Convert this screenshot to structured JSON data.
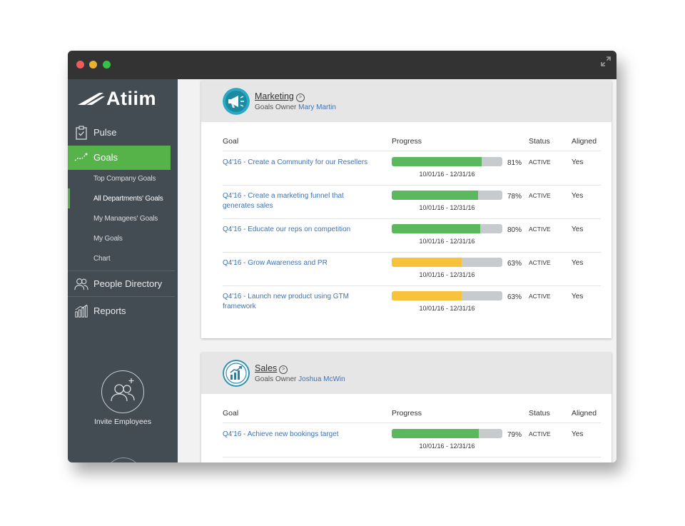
{
  "app": {
    "logo_text": "Atiim"
  },
  "sidebar": {
    "nav": [
      {
        "label": "Pulse",
        "icon": "clipboard-icon"
      },
      {
        "label": "Goals",
        "icon": "trend-icon"
      }
    ],
    "goals_submenu": [
      "Top Company Goals",
      "All Departments' Goals",
      "My Managees' Goals",
      "My Goals",
      "Chart"
    ],
    "active_submenu": "All Departments' Goals",
    "people": {
      "label": "People Directory",
      "icon": "people-icon"
    },
    "reports": {
      "label": "Reports",
      "icon": "bar-chart-icon"
    },
    "invite": {
      "label": "Invite Employees",
      "icon": "add-people-icon"
    }
  },
  "columns": {
    "goal": "Goal",
    "progress": "Progress",
    "status": "Status",
    "aligned": "Aligned"
  },
  "departments": [
    {
      "name": "Marketing",
      "owner_label": "Goals Owner",
      "owner": "Mary Martin",
      "icon": "megaphone-icon",
      "goals": [
        {
          "title": "Q4'16 - Create a Community for our Resellers",
          "progress": 81,
          "color": "#5cb85c",
          "dates": "10/01/16 - 12/31/16",
          "status": "ACTIVE",
          "aligned": "Yes"
        },
        {
          "title": "Q4'16 - Create a marketing funnel that generates sales",
          "progress": 78,
          "color": "#5cb85c",
          "dates": "10/01/16 - 12/31/16",
          "status": "ACTIVE",
          "aligned": "Yes"
        },
        {
          "title": "Q4'16 - Educate our reps on competition",
          "progress": 80,
          "color": "#5cb85c",
          "dates": "10/01/16 - 12/31/16",
          "status": "ACTIVE",
          "aligned": "Yes"
        },
        {
          "title": "Q4'16 - Grow Awareness and PR",
          "progress": 63,
          "color": "#f8c23a",
          "dates": "10/01/16 - 12/31/16",
          "status": "ACTIVE",
          "aligned": "Yes"
        },
        {
          "title": "Q4'16 - Launch new product using GTM framework",
          "progress": 63,
          "color": "#f8c23a",
          "dates": "10/01/16 - 12/31/16",
          "status": "ACTIVE",
          "aligned": "Yes"
        }
      ]
    },
    {
      "name": "Sales",
      "owner_label": "Goals Owner",
      "owner": "Joshua McWin",
      "icon": "growth-chart-icon",
      "goals": [
        {
          "title": "Q4'16 - Achieve new bookings target",
          "progress": 79,
          "color": "#5cb85c",
          "dates": "10/01/16 - 12/31/16",
          "status": "ACTIVE",
          "aligned": "Yes"
        }
      ]
    }
  ],
  "colors": {
    "sidebar": "#444c53",
    "accent": "#56b349",
    "link": "#3f73b4"
  }
}
